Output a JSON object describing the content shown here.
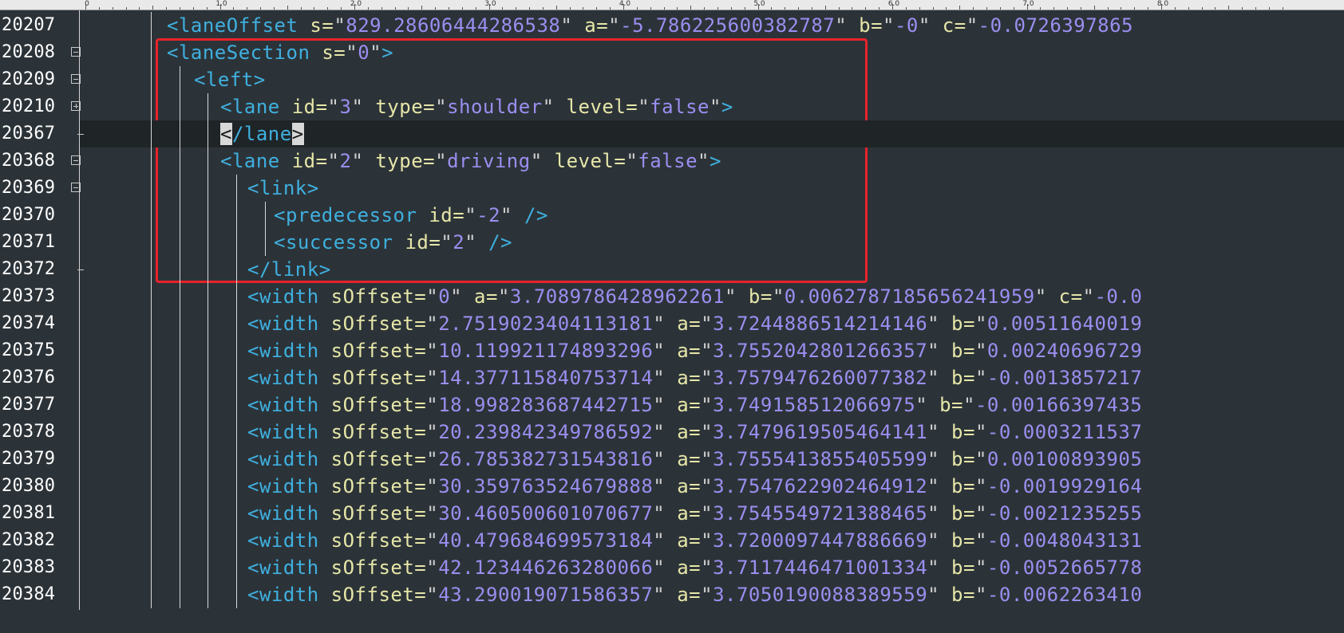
{
  "ruler": {
    "labels": [
      "0",
      "1.0",
      "2.0",
      "3.0",
      "4.0",
      "5.0",
      "6.0",
      "7.0",
      "8.0"
    ]
  },
  "colors": {
    "background": "#2c3338",
    "tag": "#3fb0e0",
    "attribute": "#e6e6a8",
    "value": "#9b8ef0",
    "highlight_box": "#e8232b"
  },
  "lines": [
    {
      "num": "20207",
      "fold": "none",
      "tokens": [
        {
          "k": "t",
          "s": "<laneOffset"
        },
        {
          "k": "a",
          "s": " s="
        },
        {
          "k": "p",
          "s": "\""
        },
        {
          "k": "v",
          "s": "829.28606444286538"
        },
        {
          "k": "p",
          "s": "\""
        },
        {
          "k": "a",
          "s": " a="
        },
        {
          "k": "p",
          "s": "\""
        },
        {
          "k": "v",
          "s": "-5.786225600382787"
        },
        {
          "k": "p",
          "s": "\""
        },
        {
          "k": "a",
          "s": " b="
        },
        {
          "k": "p",
          "s": "\""
        },
        {
          "k": "v",
          "s": "-0"
        },
        {
          "k": "p",
          "s": "\""
        },
        {
          "k": "a",
          "s": " c="
        },
        {
          "k": "p",
          "s": "\""
        },
        {
          "k": "v",
          "s": "-0.0726397865"
        }
      ]
    },
    {
      "num": "20208",
      "fold": "minus",
      "tokens": [
        {
          "k": "t",
          "s": "<laneSection"
        },
        {
          "k": "a",
          "s": " s="
        },
        {
          "k": "p",
          "s": "\""
        },
        {
          "k": "v",
          "s": "0"
        },
        {
          "k": "p",
          "s": "\""
        },
        {
          "k": "t",
          "s": ">"
        }
      ]
    },
    {
      "num": "20209",
      "fold": "minus",
      "tokens": [
        {
          "k": "t",
          "s": "<left>"
        }
      ]
    },
    {
      "num": "20210",
      "fold": "plus",
      "tokens": [
        {
          "k": "t",
          "s": "<lane"
        },
        {
          "k": "a",
          "s": " id="
        },
        {
          "k": "p",
          "s": "\""
        },
        {
          "k": "v",
          "s": "3"
        },
        {
          "k": "p",
          "s": "\""
        },
        {
          "k": "a",
          "s": " type="
        },
        {
          "k": "p",
          "s": "\""
        },
        {
          "k": "v",
          "s": "shoulder"
        },
        {
          "k": "p",
          "s": "\""
        },
        {
          "k": "a",
          "s": " level="
        },
        {
          "k": "p",
          "s": "\""
        },
        {
          "k": "v",
          "s": "false"
        },
        {
          "k": "p",
          "s": "\""
        },
        {
          "k": "t",
          "s": ">"
        }
      ]
    },
    {
      "num": "20367",
      "fold": "end",
      "current": true,
      "tokens": [
        {
          "k": "m",
          "s": "<"
        },
        {
          "k": "t",
          "s": "/lane"
        },
        {
          "k": "m",
          "s": ">"
        }
      ]
    },
    {
      "num": "20368",
      "fold": "minus",
      "tokens": [
        {
          "k": "t",
          "s": "<lane"
        },
        {
          "k": "a",
          "s": " id="
        },
        {
          "k": "p",
          "s": "\""
        },
        {
          "k": "v",
          "s": "2"
        },
        {
          "k": "p",
          "s": "\""
        },
        {
          "k": "a",
          "s": " type="
        },
        {
          "k": "p",
          "s": "\""
        },
        {
          "k": "v",
          "s": "driving"
        },
        {
          "k": "p",
          "s": "\""
        },
        {
          "k": "a",
          "s": " level="
        },
        {
          "k": "p",
          "s": "\""
        },
        {
          "k": "v",
          "s": "false"
        },
        {
          "k": "p",
          "s": "\""
        },
        {
          "k": "t",
          "s": ">"
        }
      ]
    },
    {
      "num": "20369",
      "fold": "minus",
      "tokens": [
        {
          "k": "t",
          "s": "<link>"
        }
      ]
    },
    {
      "num": "20370",
      "fold": "line",
      "tokens": [
        {
          "k": "t",
          "s": "<predecessor"
        },
        {
          "k": "a",
          "s": " id="
        },
        {
          "k": "p",
          "s": "\""
        },
        {
          "k": "v",
          "s": "-2"
        },
        {
          "k": "p",
          "s": "\""
        },
        {
          "k": "t",
          "s": " />"
        }
      ]
    },
    {
      "num": "20371",
      "fold": "line",
      "tokens": [
        {
          "k": "t",
          "s": "<successor"
        },
        {
          "k": "a",
          "s": " id="
        },
        {
          "k": "p",
          "s": "\""
        },
        {
          "k": "v",
          "s": "2"
        },
        {
          "k": "p",
          "s": "\""
        },
        {
          "k": "t",
          "s": " />"
        }
      ]
    },
    {
      "num": "20372",
      "fold": "end",
      "tokens": [
        {
          "k": "t",
          "s": "</link>"
        }
      ]
    },
    {
      "num": "20373",
      "fold": "line",
      "tokens": [
        {
          "k": "t",
          "s": "<width"
        },
        {
          "k": "a",
          "s": " sOffset="
        },
        {
          "k": "p",
          "s": "\""
        },
        {
          "k": "v",
          "s": "0"
        },
        {
          "k": "p",
          "s": "\""
        },
        {
          "k": "a",
          "s": " a="
        },
        {
          "k": "p",
          "s": "\""
        },
        {
          "k": "v",
          "s": "3.7089786428962261"
        },
        {
          "k": "p",
          "s": "\""
        },
        {
          "k": "a",
          "s": " b="
        },
        {
          "k": "p",
          "s": "\""
        },
        {
          "k": "v",
          "s": "0.0062787185656241959"
        },
        {
          "k": "p",
          "s": "\""
        },
        {
          "k": "a",
          "s": " c="
        },
        {
          "k": "p",
          "s": "\""
        },
        {
          "k": "v",
          "s": "-0.0"
        }
      ]
    },
    {
      "num": "20374",
      "fold": "line",
      "tokens": [
        {
          "k": "t",
          "s": "<width"
        },
        {
          "k": "a",
          "s": " sOffset="
        },
        {
          "k": "p",
          "s": "\""
        },
        {
          "k": "v",
          "s": "2.7519023404113181"
        },
        {
          "k": "p",
          "s": "\""
        },
        {
          "k": "a",
          "s": " a="
        },
        {
          "k": "p",
          "s": "\""
        },
        {
          "k": "v",
          "s": "3.7244886514214146"
        },
        {
          "k": "p",
          "s": "\""
        },
        {
          "k": "a",
          "s": " b="
        },
        {
          "k": "p",
          "s": "\""
        },
        {
          "k": "v",
          "s": "0.00511640019"
        }
      ]
    },
    {
      "num": "20375",
      "fold": "line",
      "tokens": [
        {
          "k": "t",
          "s": "<width"
        },
        {
          "k": "a",
          "s": " sOffset="
        },
        {
          "k": "p",
          "s": "\""
        },
        {
          "k": "v",
          "s": "10.119921174893296"
        },
        {
          "k": "p",
          "s": "\""
        },
        {
          "k": "a",
          "s": " a="
        },
        {
          "k": "p",
          "s": "\""
        },
        {
          "k": "v",
          "s": "3.7552042801266357"
        },
        {
          "k": "p",
          "s": "\""
        },
        {
          "k": "a",
          "s": " b="
        },
        {
          "k": "p",
          "s": "\""
        },
        {
          "k": "v",
          "s": "0.00240696729"
        }
      ]
    },
    {
      "num": "20376",
      "fold": "line",
      "tokens": [
        {
          "k": "t",
          "s": "<width"
        },
        {
          "k": "a",
          "s": " sOffset="
        },
        {
          "k": "p",
          "s": "\""
        },
        {
          "k": "v",
          "s": "14.377115840753714"
        },
        {
          "k": "p",
          "s": "\""
        },
        {
          "k": "a",
          "s": " a="
        },
        {
          "k": "p",
          "s": "\""
        },
        {
          "k": "v",
          "s": "3.7579476260077382"
        },
        {
          "k": "p",
          "s": "\""
        },
        {
          "k": "a",
          "s": " b="
        },
        {
          "k": "p",
          "s": "\""
        },
        {
          "k": "v",
          "s": "-0.0013857217"
        }
      ]
    },
    {
      "num": "20377",
      "fold": "line",
      "tokens": [
        {
          "k": "t",
          "s": "<width"
        },
        {
          "k": "a",
          "s": " sOffset="
        },
        {
          "k": "p",
          "s": "\""
        },
        {
          "k": "v",
          "s": "18.998283687442715"
        },
        {
          "k": "p",
          "s": "\""
        },
        {
          "k": "a",
          "s": " a="
        },
        {
          "k": "p",
          "s": "\""
        },
        {
          "k": "v",
          "s": "3.749158512066975"
        },
        {
          "k": "p",
          "s": "\""
        },
        {
          "k": "a",
          "s": " b="
        },
        {
          "k": "p",
          "s": "\""
        },
        {
          "k": "v",
          "s": "-0.00166397435"
        }
      ]
    },
    {
      "num": "20378",
      "fold": "line",
      "tokens": [
        {
          "k": "t",
          "s": "<width"
        },
        {
          "k": "a",
          "s": " sOffset="
        },
        {
          "k": "p",
          "s": "\""
        },
        {
          "k": "v",
          "s": "20.239842349786592"
        },
        {
          "k": "p",
          "s": "\""
        },
        {
          "k": "a",
          "s": " a="
        },
        {
          "k": "p",
          "s": "\""
        },
        {
          "k": "v",
          "s": "3.7479619505464141"
        },
        {
          "k": "p",
          "s": "\""
        },
        {
          "k": "a",
          "s": " b="
        },
        {
          "k": "p",
          "s": "\""
        },
        {
          "k": "v",
          "s": "-0.0003211537"
        }
      ]
    },
    {
      "num": "20379",
      "fold": "line",
      "tokens": [
        {
          "k": "t",
          "s": "<width"
        },
        {
          "k": "a",
          "s": " sOffset="
        },
        {
          "k": "p",
          "s": "\""
        },
        {
          "k": "v",
          "s": "26.785382731543816"
        },
        {
          "k": "p",
          "s": "\""
        },
        {
          "k": "a",
          "s": " a="
        },
        {
          "k": "p",
          "s": "\""
        },
        {
          "k": "v",
          "s": "3.7555413855405599"
        },
        {
          "k": "p",
          "s": "\""
        },
        {
          "k": "a",
          "s": " b="
        },
        {
          "k": "p",
          "s": "\""
        },
        {
          "k": "v",
          "s": "0.00100893905"
        }
      ]
    },
    {
      "num": "20380",
      "fold": "line",
      "tokens": [
        {
          "k": "t",
          "s": "<width"
        },
        {
          "k": "a",
          "s": " sOffset="
        },
        {
          "k": "p",
          "s": "\""
        },
        {
          "k": "v",
          "s": "30.359763524679888"
        },
        {
          "k": "p",
          "s": "\""
        },
        {
          "k": "a",
          "s": " a="
        },
        {
          "k": "p",
          "s": "\""
        },
        {
          "k": "v",
          "s": "3.7547622902464912"
        },
        {
          "k": "p",
          "s": "\""
        },
        {
          "k": "a",
          "s": " b="
        },
        {
          "k": "p",
          "s": "\""
        },
        {
          "k": "v",
          "s": "-0.0019929164"
        }
      ]
    },
    {
      "num": "20381",
      "fold": "line",
      "tokens": [
        {
          "k": "t",
          "s": "<width"
        },
        {
          "k": "a",
          "s": " sOffset="
        },
        {
          "k": "p",
          "s": "\""
        },
        {
          "k": "v",
          "s": "30.460500601070677"
        },
        {
          "k": "p",
          "s": "\""
        },
        {
          "k": "a",
          "s": " a="
        },
        {
          "k": "p",
          "s": "\""
        },
        {
          "k": "v",
          "s": "3.7545549721388465"
        },
        {
          "k": "p",
          "s": "\""
        },
        {
          "k": "a",
          "s": " b="
        },
        {
          "k": "p",
          "s": "\""
        },
        {
          "k": "v",
          "s": "-0.0021235255"
        }
      ]
    },
    {
      "num": "20382",
      "fold": "line",
      "tokens": [
        {
          "k": "t",
          "s": "<width"
        },
        {
          "k": "a",
          "s": " sOffset="
        },
        {
          "k": "p",
          "s": "\""
        },
        {
          "k": "v",
          "s": "40.479684699573184"
        },
        {
          "k": "p",
          "s": "\""
        },
        {
          "k": "a",
          "s": " a="
        },
        {
          "k": "p",
          "s": "\""
        },
        {
          "k": "v",
          "s": "3.7200097447886669"
        },
        {
          "k": "p",
          "s": "\""
        },
        {
          "k": "a",
          "s": " b="
        },
        {
          "k": "p",
          "s": "\""
        },
        {
          "k": "v",
          "s": "-0.0048043131"
        }
      ]
    },
    {
      "num": "20383",
      "fold": "line",
      "tokens": [
        {
          "k": "t",
          "s": "<width"
        },
        {
          "k": "a",
          "s": " sOffset="
        },
        {
          "k": "p",
          "s": "\""
        },
        {
          "k": "v",
          "s": "42.123446263280066"
        },
        {
          "k": "p",
          "s": "\""
        },
        {
          "k": "a",
          "s": " a="
        },
        {
          "k": "p",
          "s": "\""
        },
        {
          "k": "v",
          "s": "3.7117446471001334"
        },
        {
          "k": "p",
          "s": "\""
        },
        {
          "k": "a",
          "s": " b="
        },
        {
          "k": "p",
          "s": "\""
        },
        {
          "k": "v",
          "s": "-0.0052665778"
        }
      ]
    },
    {
      "num": "20384",
      "fold": "line",
      "tokens": [
        {
          "k": "t",
          "s": "<width"
        },
        {
          "k": "a",
          "s": " sOffset="
        },
        {
          "k": "p",
          "s": "\""
        },
        {
          "k": "v",
          "s": "43.290019071586357"
        },
        {
          "k": "p",
          "s": "\""
        },
        {
          "k": "a",
          "s": " a="
        },
        {
          "k": "p",
          "s": "\""
        },
        {
          "k": "v",
          "s": "3.7050190088389559"
        },
        {
          "k": "p",
          "s": "\""
        },
        {
          "k": "a",
          "s": " b="
        },
        {
          "k": "p",
          "s": "\""
        },
        {
          "k": "v",
          "s": "-0.0062263410"
        }
      ]
    }
  ]
}
